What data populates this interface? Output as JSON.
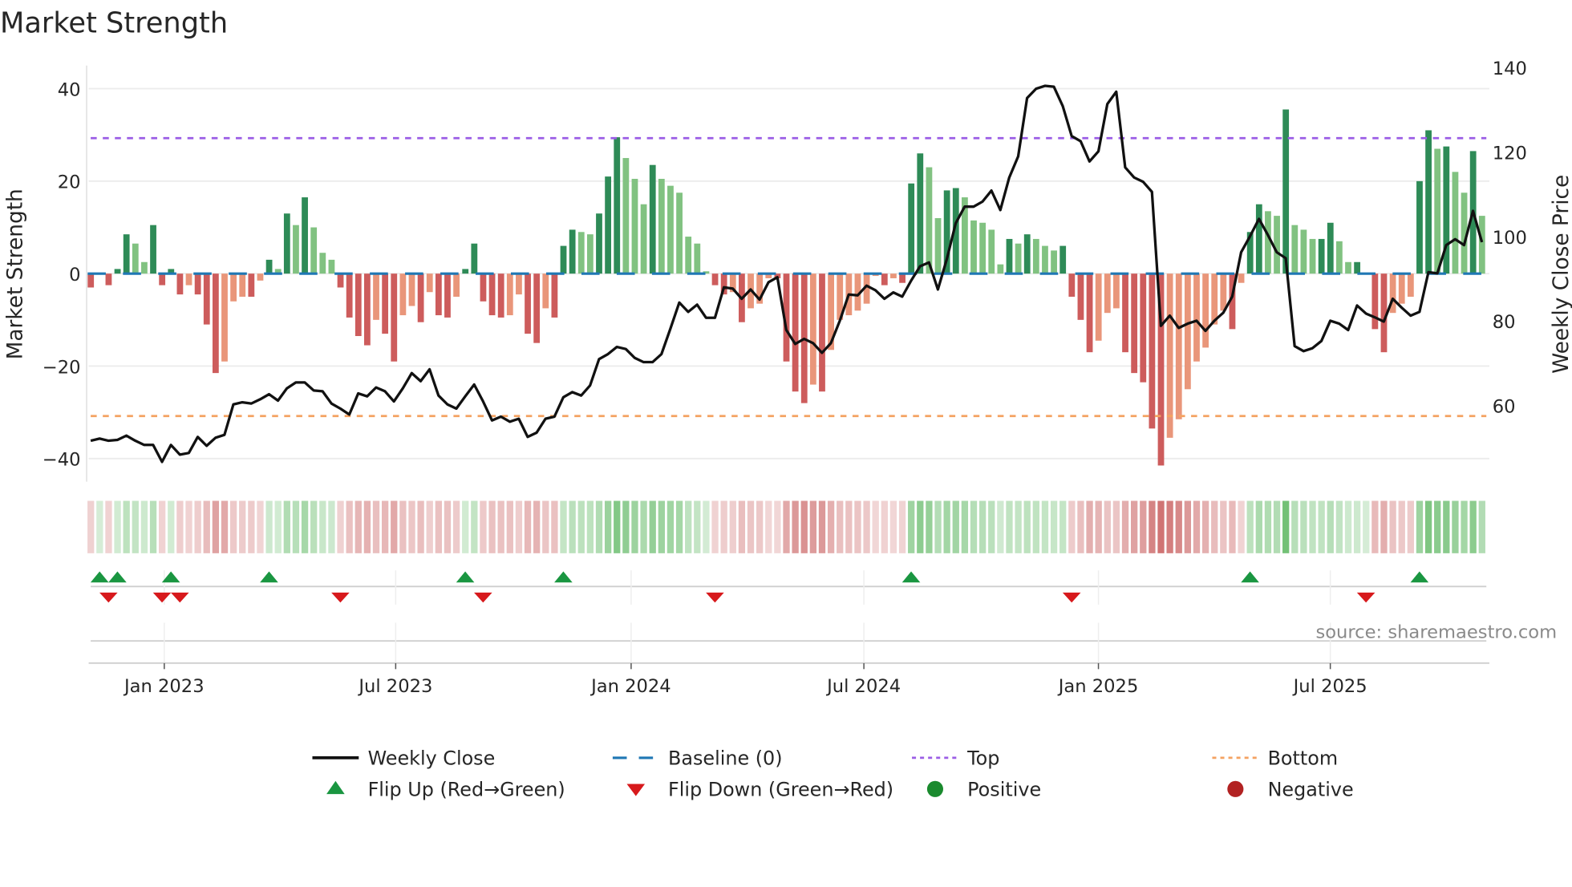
{
  "chart_data": {
    "type": "bar",
    "title": "Market Strength",
    "ylabel": "Market Strength",
    "y2label": "Weekly Close Price",
    "ylim": [
      -45,
      45
    ],
    "y2lim": [
      42,
      140.5
    ],
    "yticks": [
      -40,
      -20,
      0,
      20,
      40
    ],
    "yticklabels": [
      "−40",
      "−20",
      "0",
      "20",
      "40"
    ],
    "y2ticks": [
      60,
      80,
      100,
      120,
      140
    ],
    "y2ticklabels": [
      "60",
      "80",
      "100",
      "120",
      "140"
    ],
    "xticks": [
      {
        "week": 8.25,
        "label": "Jan 2023"
      },
      {
        "week": 34.2,
        "label": "Jul 2023"
      },
      {
        "week": 60.6,
        "label": "Jan 2024"
      },
      {
        "week": 86.7,
        "label": "Jul 2024"
      },
      {
        "week": 113,
        "label": "Jan 2025"
      },
      {
        "week": 139,
        "label": "Jul 2025"
      }
    ],
    "top_level": 29.3,
    "bottom_level": -30.8,
    "baseline": 0,
    "strength": [
      -3,
      0,
      -2.5,
      1,
      8.5,
      6.5,
      2.5,
      10.5,
      -2.5,
      1,
      -4.5,
      -2.5,
      -4.5,
      -11,
      -21.5,
      -19,
      -6,
      -5,
      -5,
      -1.5,
      3,
      1,
      13,
      10.5,
      16.5,
      10,
      4.5,
      3,
      -3,
      -9.5,
      -13.5,
      -15.5,
      -10,
      -13,
      -19,
      -9,
      -7,
      -10.5,
      -4,
      -9,
      -9.5,
      -5,
      1,
      6.5,
      -6,
      -9,
      -9.5,
      -9,
      -4.5,
      -13,
      -15,
      -7.5,
      -9.5,
      6,
      9.5,
      9,
      8.5,
      13,
      21,
      29.5,
      25,
      20.5,
      15,
      23.5,
      20.5,
      19,
      17.5,
      8,
      6.5,
      0.5,
      -2.5,
      -4.5,
      -4,
      -10.5,
      -7.5,
      -6.5,
      -1,
      -1,
      -19,
      -25.5,
      -28,
      -24,
      -25.5,
      -16.5,
      -10,
      -9,
      -8,
      -6.5,
      -0.5,
      -2.5,
      -1,
      -2,
      19.5,
      26,
      23,
      12,
      18,
      18.5,
      16.5,
      11.5,
      11,
      9.5,
      2,
      7.5,
      6.5,
      8.5,
      7.5,
      6,
      5,
      6,
      -5,
      -10,
      -17,
      -14.5,
      -8.5,
      -7.5,
      -17,
      -21.5,
      -23.5,
      -33.5,
      -41.5,
      -35.5,
      -31.5,
      -25,
      -19,
      -16,
      -11,
      -8,
      -12,
      -2,
      9,
      15,
      13.5,
      12.5,
      35.5,
      10.5,
      9.5,
      7.5,
      7.5,
      11,
      7,
      2.5,
      2.5,
      0,
      -12,
      -17,
      -8.5,
      -6.5,
      -5,
      20,
      31,
      27,
      27.5,
      22,
      17.5,
      26.5,
      12.5
    ],
    "weekly_close": [
      51.7,
      52.2,
      51.7,
      51.9,
      52.9,
      51.7,
      50.7,
      50.7,
      46.7,
      50.7,
      48.4,
      48.8,
      52.6,
      50.5,
      52.4,
      53.1,
      60.3,
      60.8,
      60.5,
      61.5,
      62.7,
      61.2,
      64.1,
      65.5,
      65.5,
      63.6,
      63.4,
      60.5,
      59.3,
      57.9,
      62.9,
      62.2,
      64.3,
      63.4,
      61.0,
      64.1,
      67.7,
      65.8,
      68.6,
      62.4,
      60.3,
      59.3,
      62.2,
      65.0,
      61.0,
      56.5,
      57.4,
      56.2,
      56.9,
      52.6,
      53.6,
      56.9,
      57.4,
      62.0,
      63.2,
      62.4,
      64.8,
      71.0,
      72.2,
      73.9,
      73.4,
      71.3,
      70.3,
      70.3,
      72.2,
      78.2,
      84.4,
      82.2,
      83.9,
      80.8,
      80.8,
      88.0,
      87.7,
      85.3,
      87.5,
      85.1,
      89.2,
      90.4,
      77.9,
      74.6,
      75.8,
      74.8,
      72.5,
      74.8,
      80.1,
      86.3,
      86.1,
      88.4,
      87.3,
      85.3,
      86.8,
      85.8,
      89.6,
      93.0,
      93.9,
      87.5,
      94.7,
      103.2,
      107.1,
      107.1,
      108.3,
      110.9,
      106.3,
      114.0,
      119.0,
      132.8,
      135.0,
      135.7,
      135.5,
      130.9,
      123.8,
      122.6,
      117.8,
      120.2,
      131.4,
      134.3,
      116.4,
      114.0,
      113.0,
      110.6,
      78.9,
      81.3,
      78.4,
      79.4,
      80.1,
      77.7,
      80.1,
      82.0,
      85.8,
      96.3,
      100.1,
      104.2,
      100.4,
      96.3,
      94.9,
      74.1,
      72.9,
      73.6,
      75.3,
      80.1,
      79.4,
      77.9,
      83.7,
      81.8,
      80.9,
      79.9,
      85.3,
      83.2,
      81.3,
      82.2,
      91.6,
      91.3,
      98.0,
      99.4,
      98.0,
      106.1,
      98.7
    ],
    "flip_up_weeks": [
      1,
      3,
      9,
      20,
      42,
      53,
      92,
      130,
      149
    ],
    "flip_down_weeks": [
      2,
      8,
      10,
      28,
      44,
      70,
      110,
      143
    ],
    "legend": {
      "placement": "bottom",
      "items": [
        {
          "key": "line",
          "label": "Weekly Close"
        },
        {
          "key": "baseline",
          "label": "Baseline (0)"
        },
        {
          "key": "top",
          "label": "Top"
        },
        {
          "key": "bottom",
          "label": "Bottom"
        },
        {
          "key": "flip_up",
          "label": "Flip Up (Red→Green)"
        },
        {
          "key": "flip_down",
          "label": "Flip Down (Green→Red)"
        },
        {
          "key": "positive",
          "label": "Positive"
        },
        {
          "key": "negative",
          "label": "Negative"
        }
      ]
    },
    "source": "source: sharemaestro.com",
    "colors": {
      "dark_green": "#2e8b57",
      "light_green": "#81c281",
      "dark_red": "#cd5c5c",
      "light_red": "#e9967a",
      "baseline": "#1f77b4",
      "top": "#9b5de5",
      "bottom": "#f4a261",
      "flip_up": "#1a9641",
      "flip_down": "#d7191c",
      "positive": "#1a8a2e",
      "negative": "#b22222",
      "line": "#111111"
    }
  }
}
